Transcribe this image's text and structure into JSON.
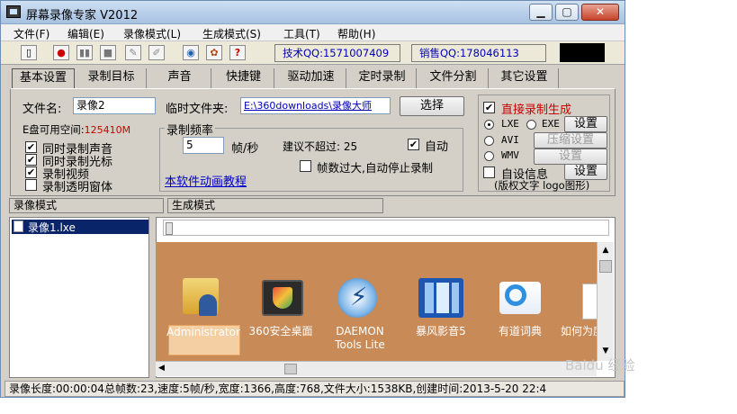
{
  "window": {
    "title": "屏幕录像专家 V2012"
  },
  "menu": [
    "文件(F)",
    "编辑(E)",
    "录像模式(L)",
    "生成模式(S)",
    "工具(T)",
    "帮助(H)"
  ],
  "toolbar": {
    "tech_qq": "技术QQ:1571007409",
    "sales_qq": "销售QQ:178046113"
  },
  "tabs": [
    "基本设置",
    "录制目标",
    "声音",
    "快捷键",
    "驱动加速",
    "定时录制",
    "文件分割",
    "其它设置"
  ],
  "basic": {
    "filename_label": "文件名:",
    "filename_value": "录像2",
    "tempfolder_label": "临时文件夹:",
    "tempfolder_value": "E:\\360downloads\\录像大师",
    "select_button": "选择",
    "disk_space_label": "E盘可用空间:",
    "disk_space_value": "125410M",
    "checkboxes": [
      {
        "label": "同时录制声音",
        "checked": true
      },
      {
        "label": "同时录制光标",
        "checked": true
      },
      {
        "label": "录制视频",
        "checked": true
      },
      {
        "label": "录制透明窗体",
        "checked": false
      }
    ],
    "frequency_group": "录制频率",
    "frequency_value": "5",
    "frequency_unit": "帧/秒",
    "suggest_label": "建议不超过: 25",
    "auto_label": "自动",
    "auto_checked": true,
    "stop_label": "帧数过大,自动停止录制",
    "stop_checked": false,
    "tutorial_link": "本软件动画教程"
  },
  "output": {
    "direct_label": "直接录制生成",
    "direct_checked": true,
    "formats": [
      {
        "label": "LXE",
        "selected": true
      },
      {
        "label": "EXE",
        "selected": false
      },
      {
        "label": "AVI",
        "selected": false
      },
      {
        "label": "WMV",
        "selected": false
      }
    ],
    "settings_button": "设置",
    "compress_button": "压缩设置",
    "settings_button_2": "设置",
    "custom_info_label": "自设信息",
    "custom_info_checked": false,
    "custom_info_button": "设置",
    "copyright_text": "(版权文字 logo图形)"
  },
  "modes": {
    "record": "录像模式",
    "generate": "生成模式"
  },
  "file_list": [
    "录像1.lxe"
  ],
  "desktop_icons": [
    {
      "label": "Administrator",
      "icon": "user-folder-icon"
    },
    {
      "label": "360安全桌面",
      "icon": "360-desktop-icon"
    },
    {
      "label": "DAEMON Tools Lite",
      "icon": "daemon-tools-icon"
    },
    {
      "label": "暴风影音5",
      "icon": "baofeng-icon"
    },
    {
      "label": "有道词典",
      "icon": "youdao-dict-icon"
    },
    {
      "label": "如何为度经验",
      "icon": "document-icon"
    }
  ],
  "status": "录像长度:00:00:04总帧数:23,速度:5帧/秒,宽度:1366,高度:768,文件大小:1538KB,创建时间:2013-5-20 22:4",
  "watermark": "Baidu 经验"
}
